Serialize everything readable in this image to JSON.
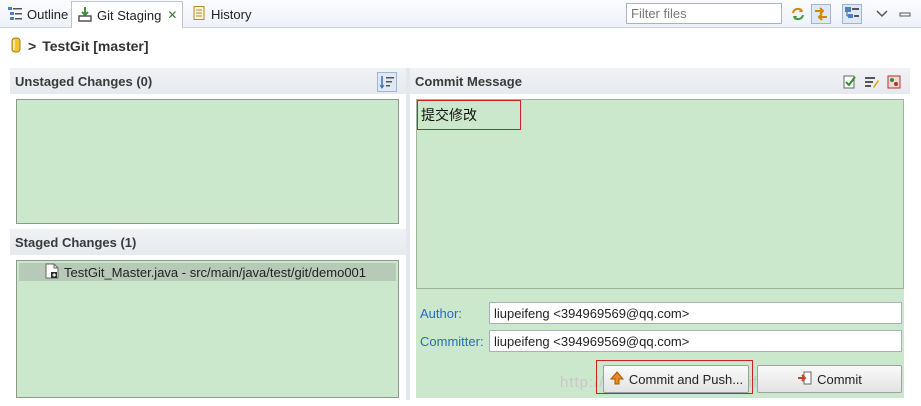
{
  "tabs": [
    {
      "label": "Outline",
      "icon": "outline-icon"
    },
    {
      "label": "Git Staging",
      "icon": "git-staging-icon",
      "active": true
    },
    {
      "label": "History",
      "icon": "history-icon"
    }
  ],
  "close_glyph": "✕",
  "filter": {
    "placeholder": "Filter files"
  },
  "toolbar_icons": [
    "refresh-icon",
    "link-with-selection-icon",
    "tree-view-icon",
    "view-menu-icon"
  ],
  "breadcrumb": {
    "separator": ">",
    "repo": "TestGit [master]",
    "icon": "repository-icon"
  },
  "unstaged": {
    "title": "Unstaged Changes (0)",
    "icon": "sort-icon"
  },
  "staged": {
    "title": "Staged Changes (1)",
    "files": [
      "TestGit_Master.java - src/main/java/test/git/demo001"
    ]
  },
  "commit": {
    "title": "Commit Message",
    "icons": [
      "add-signed-off-icon",
      "amend-icon",
      "gerrit-change-icon"
    ],
    "message": "提交修改",
    "author_label": "Author:",
    "author_value": "liupeifeng <394969569@qq.com>",
    "committer_label": "Committer:",
    "committer_value": "liupeifeng <394969569@qq.com>",
    "commit_push_label": "Commit and Push...",
    "commit_label": "Commit"
  },
  "watermark": "http://blog.csdn.net/liupeifeng3514",
  "colors": {
    "staging_green": "#cce8cc",
    "label_blue": "#2a6ab8",
    "highlight_red": "#cc2222"
  }
}
